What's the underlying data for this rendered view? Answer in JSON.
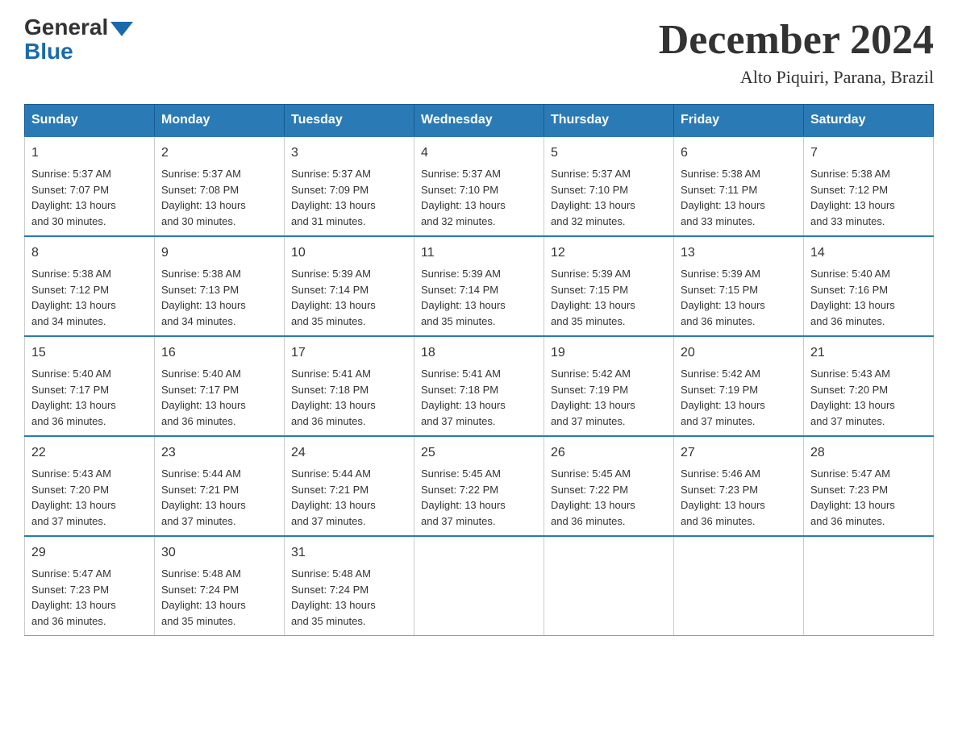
{
  "header": {
    "logo_general": "General",
    "logo_blue": "Blue",
    "month_title": "December 2024",
    "location": "Alto Piquiri, Parana, Brazil"
  },
  "days_of_week": [
    "Sunday",
    "Monday",
    "Tuesday",
    "Wednesday",
    "Thursday",
    "Friday",
    "Saturday"
  ],
  "weeks": [
    [
      {
        "day": "1",
        "sunrise": "5:37 AM",
        "sunset": "7:07 PM",
        "daylight": "13 hours and 30 minutes."
      },
      {
        "day": "2",
        "sunrise": "5:37 AM",
        "sunset": "7:08 PM",
        "daylight": "13 hours and 30 minutes."
      },
      {
        "day": "3",
        "sunrise": "5:37 AM",
        "sunset": "7:09 PM",
        "daylight": "13 hours and 31 minutes."
      },
      {
        "day": "4",
        "sunrise": "5:37 AM",
        "sunset": "7:10 PM",
        "daylight": "13 hours and 32 minutes."
      },
      {
        "day": "5",
        "sunrise": "5:37 AM",
        "sunset": "7:10 PM",
        "daylight": "13 hours and 32 minutes."
      },
      {
        "day": "6",
        "sunrise": "5:38 AM",
        "sunset": "7:11 PM",
        "daylight": "13 hours and 33 minutes."
      },
      {
        "day": "7",
        "sunrise": "5:38 AM",
        "sunset": "7:12 PM",
        "daylight": "13 hours and 33 minutes."
      }
    ],
    [
      {
        "day": "8",
        "sunrise": "5:38 AM",
        "sunset": "7:12 PM",
        "daylight": "13 hours and 34 minutes."
      },
      {
        "day": "9",
        "sunrise": "5:38 AM",
        "sunset": "7:13 PM",
        "daylight": "13 hours and 34 minutes."
      },
      {
        "day": "10",
        "sunrise": "5:39 AM",
        "sunset": "7:14 PM",
        "daylight": "13 hours and 35 minutes."
      },
      {
        "day": "11",
        "sunrise": "5:39 AM",
        "sunset": "7:14 PM",
        "daylight": "13 hours and 35 minutes."
      },
      {
        "day": "12",
        "sunrise": "5:39 AM",
        "sunset": "7:15 PM",
        "daylight": "13 hours and 35 minutes."
      },
      {
        "day": "13",
        "sunrise": "5:39 AM",
        "sunset": "7:15 PM",
        "daylight": "13 hours and 36 minutes."
      },
      {
        "day": "14",
        "sunrise": "5:40 AM",
        "sunset": "7:16 PM",
        "daylight": "13 hours and 36 minutes."
      }
    ],
    [
      {
        "day": "15",
        "sunrise": "5:40 AM",
        "sunset": "7:17 PM",
        "daylight": "13 hours and 36 minutes."
      },
      {
        "day": "16",
        "sunrise": "5:40 AM",
        "sunset": "7:17 PM",
        "daylight": "13 hours and 36 minutes."
      },
      {
        "day": "17",
        "sunrise": "5:41 AM",
        "sunset": "7:18 PM",
        "daylight": "13 hours and 36 minutes."
      },
      {
        "day": "18",
        "sunrise": "5:41 AM",
        "sunset": "7:18 PM",
        "daylight": "13 hours and 37 minutes."
      },
      {
        "day": "19",
        "sunrise": "5:42 AM",
        "sunset": "7:19 PM",
        "daylight": "13 hours and 37 minutes."
      },
      {
        "day": "20",
        "sunrise": "5:42 AM",
        "sunset": "7:19 PM",
        "daylight": "13 hours and 37 minutes."
      },
      {
        "day": "21",
        "sunrise": "5:43 AM",
        "sunset": "7:20 PM",
        "daylight": "13 hours and 37 minutes."
      }
    ],
    [
      {
        "day": "22",
        "sunrise": "5:43 AM",
        "sunset": "7:20 PM",
        "daylight": "13 hours and 37 minutes."
      },
      {
        "day": "23",
        "sunrise": "5:44 AM",
        "sunset": "7:21 PM",
        "daylight": "13 hours and 37 minutes."
      },
      {
        "day": "24",
        "sunrise": "5:44 AM",
        "sunset": "7:21 PM",
        "daylight": "13 hours and 37 minutes."
      },
      {
        "day": "25",
        "sunrise": "5:45 AM",
        "sunset": "7:22 PM",
        "daylight": "13 hours and 37 minutes."
      },
      {
        "day": "26",
        "sunrise": "5:45 AM",
        "sunset": "7:22 PM",
        "daylight": "13 hours and 36 minutes."
      },
      {
        "day": "27",
        "sunrise": "5:46 AM",
        "sunset": "7:23 PM",
        "daylight": "13 hours and 36 minutes."
      },
      {
        "day": "28",
        "sunrise": "5:47 AM",
        "sunset": "7:23 PM",
        "daylight": "13 hours and 36 minutes."
      }
    ],
    [
      {
        "day": "29",
        "sunrise": "5:47 AM",
        "sunset": "7:23 PM",
        "daylight": "13 hours and 36 minutes."
      },
      {
        "day": "30",
        "sunrise": "5:48 AM",
        "sunset": "7:24 PM",
        "daylight": "13 hours and 35 minutes."
      },
      {
        "day": "31",
        "sunrise": "5:48 AM",
        "sunset": "7:24 PM",
        "daylight": "13 hours and 35 minutes."
      },
      null,
      null,
      null,
      null
    ]
  ],
  "labels": {
    "sunrise": "Sunrise:",
    "sunset": "Sunset:",
    "daylight": "Daylight:"
  }
}
